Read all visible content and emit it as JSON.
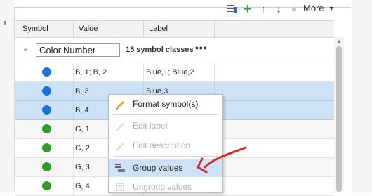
{
  "toolbar": {
    "more_label": "More"
  },
  "table": {
    "columns": [
      "Symbol",
      "Value",
      "Label"
    ],
    "group": {
      "name": "Color,Number",
      "count_text": "15 symbol classes",
      "options_glyph": "•••"
    },
    "rows": [
      {
        "color": "#1475e0",
        "value": "B, 1; B, 2",
        "label": "Blue,1; Blue,2",
        "state": "normal"
      },
      {
        "color": "#1475e0",
        "value": "B, 3",
        "label": "Blue,3",
        "state": "selected"
      },
      {
        "color": "#1475e0",
        "value": "B, 4",
        "label": "",
        "state": "selected"
      },
      {
        "color": "#2f9e25",
        "value": "G, 1",
        "label": "",
        "state": "gray"
      },
      {
        "color": "#2f9e25",
        "value": "G, 2",
        "label": "",
        "state": "normal"
      },
      {
        "color": "#2f9e25",
        "value": "G, 3",
        "label": "",
        "state": "gray"
      },
      {
        "color": "#2f9e25",
        "value": "G, 4",
        "label": "",
        "state": "normal"
      }
    ]
  },
  "context_menu": {
    "items": [
      {
        "label": "Format symbol(s)",
        "icon": "pencil-icon",
        "enabled": true
      },
      {
        "label": "Edit label",
        "icon": "pencil-icon",
        "enabled": false
      },
      {
        "label": "Edit description",
        "icon": "pencil-icon",
        "enabled": false
      },
      {
        "label": "Group values",
        "icon": "group-values-icon",
        "enabled": true
      },
      {
        "label": "Ungroup values",
        "icon": "ungroup-values-icon",
        "enabled": false
      }
    ]
  },
  "colors": {
    "accent_selection": "#cde3f5",
    "blue_symbol": "#1475e0",
    "green_symbol": "#2f9e25",
    "annotation_arrow": "#d9262b"
  }
}
